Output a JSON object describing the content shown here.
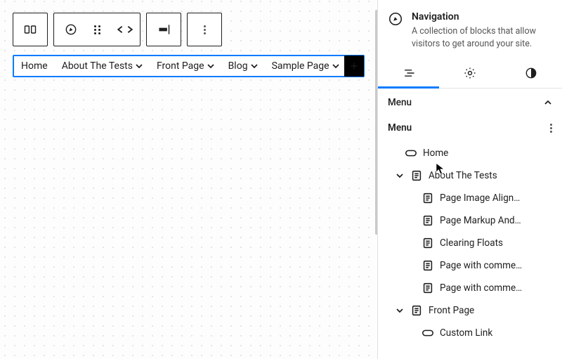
{
  "toolbar": {
    "nav_block_icon": "navigation",
    "compass_icon": "compass",
    "drag_icon": "drag-handle",
    "chevron_left": "<",
    "chevron_right": ">",
    "justify_icon": "justify-content",
    "more_icon": "more-vertical"
  },
  "nav": {
    "items": [
      {
        "label": "Home",
        "submenu": false
      },
      {
        "label": "About The Tests",
        "submenu": true
      },
      {
        "label": "Front Page",
        "submenu": true
      },
      {
        "label": "Blog",
        "submenu": true
      },
      {
        "label": "Sample Page",
        "submenu": true
      }
    ],
    "add_label": "+"
  },
  "sidebar": {
    "title": "Navigation",
    "description": "A collection of blocks that allow visitors to get around your site.",
    "tabs": {
      "list": "list",
      "settings": "settings",
      "styles": "styles"
    },
    "section_label": "Menu",
    "menu_label": "Menu",
    "tree": [
      {
        "depth": 0,
        "icon": "link",
        "label": "Home",
        "expander": "none"
      },
      {
        "depth": 0,
        "icon": "page",
        "label": "About The Tests",
        "expander": "open"
      },
      {
        "depth": 1,
        "icon": "page",
        "label": "Page Image Align…",
        "expander": "none"
      },
      {
        "depth": 1,
        "icon": "page",
        "label": "Page Markup And…",
        "expander": "none"
      },
      {
        "depth": 1,
        "icon": "page",
        "label": "Clearing Floats",
        "expander": "none"
      },
      {
        "depth": 1,
        "icon": "page",
        "label": "Page with comme…",
        "expander": "none"
      },
      {
        "depth": 1,
        "icon": "page",
        "label": "Page with comme…",
        "expander": "none"
      },
      {
        "depth": 0,
        "icon": "page",
        "label": "Front Page",
        "expander": "open"
      },
      {
        "depth": 1,
        "icon": "link",
        "label": "Custom Link",
        "expander": "none"
      }
    ]
  }
}
